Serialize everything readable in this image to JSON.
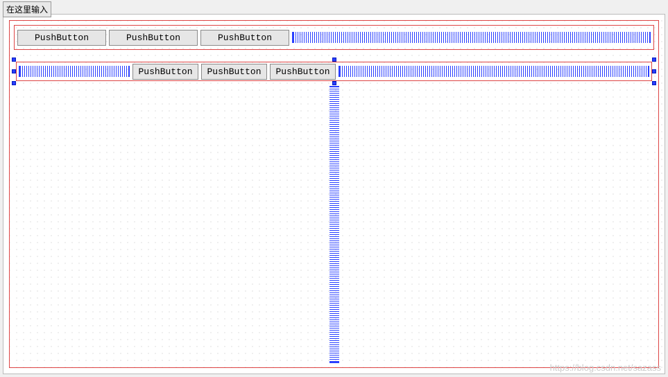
{
  "title": "在这里输入",
  "row1": {
    "buttons": [
      {
        "label": "PushButton"
      },
      {
        "label": "PushButton"
      },
      {
        "label": "PushButton"
      }
    ]
  },
  "row2": {
    "buttons": [
      {
        "label": "PushButton"
      },
      {
        "label": "PushButton"
      },
      {
        "label": "PushButton"
      }
    ]
  },
  "watermark": "https://blog.csdn.net/sazass"
}
